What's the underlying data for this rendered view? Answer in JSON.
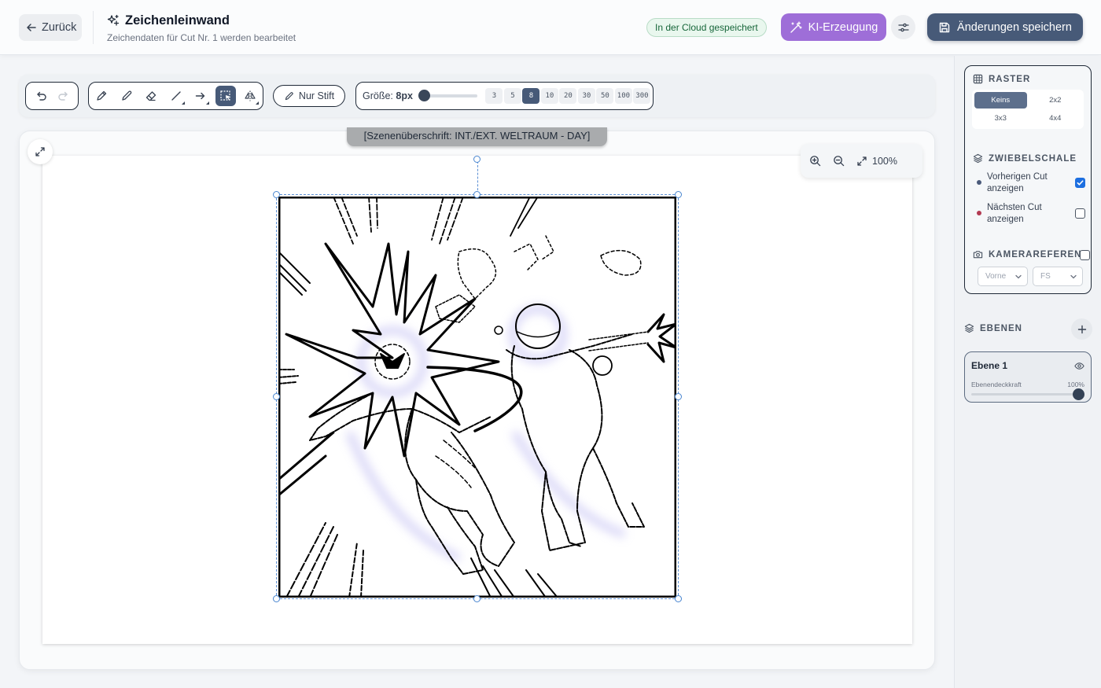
{
  "header": {
    "back_label": "Zurück",
    "title": "Zeichenleinwand",
    "subtitle": "Zeichendaten für Cut Nr. 1 werden bearbeitet",
    "cloud_status": "In der Cloud gespeichert",
    "ai_label": "KI-Erzeugung",
    "save_label": "Änderungen speichern"
  },
  "toolbar": {
    "history_tools": [
      "undo-icon",
      "redo-icon"
    ],
    "drawing_tools": [
      "pencil-icon",
      "pen-icon",
      "eraser-icon",
      "line-icon",
      "arrow-icon",
      "select-icon",
      "flip-icon"
    ],
    "active_tool": "select-icon",
    "pen_only_label": "Nur Stift",
    "size_label": "Größe:",
    "size_value": "8px",
    "size_options": [
      "3",
      "5",
      "8",
      "10",
      "20",
      "30",
      "50",
      "100",
      "300"
    ],
    "active_size": "8"
  },
  "canvas": {
    "scene_heading": "[Szenenüberschrift: INT./EXT. WELTRAUM - DAY]",
    "zoom_level": "100%"
  },
  "sidebar": {
    "grid": {
      "title": "RASTER",
      "options": [
        "Keins",
        "2x2",
        "3x3",
        "4x4"
      ],
      "active": "Keins"
    },
    "onion": {
      "title": "ZWIEBELSCHALE",
      "previous_label": "Vorherigen Cut anzeigen",
      "previous_checked": true,
      "previous_color": "#4a5a7a",
      "next_label": "Nächsten Cut anzeigen",
      "next_checked": false,
      "next_color": "#b23a52"
    },
    "camera": {
      "title": "KAMERAREFERENZ",
      "enabled": false,
      "view_value": "Vorne",
      "shot_value": "FS"
    },
    "layers": {
      "title": "EBENEN",
      "items": [
        {
          "name": "Ebene 1",
          "opacity_label": "Ebenendeckkraft",
          "opacity_value": "100%",
          "opacity": 1.0
        }
      ]
    }
  },
  "colors": {
    "ai_button": "#9e6ed8",
    "save_button": "#475a78",
    "active_accent": "#475a78",
    "selection": "#4a86d0"
  }
}
